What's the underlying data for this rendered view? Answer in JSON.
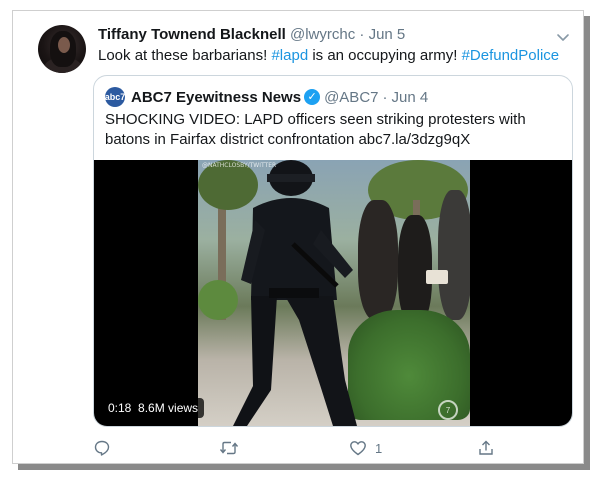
{
  "tweet": {
    "author_name": "Tiffany Townend Blacknell",
    "handle": "@lwyrchc",
    "separator": "·",
    "date": "Jun 5",
    "text_before": "Look at these barbarians! ",
    "hashtag_lapd": "#lapd",
    "text_middle": " is an occupying army! ",
    "hashtag_defund": "#DefundPolice"
  },
  "quoted": {
    "avatar_label": "abc7",
    "author_name": "ABC7 Eyewitness News",
    "handle": "@ABC7",
    "separator": "·",
    "date": "Jun 4",
    "text": "SHOCKING VIDEO: LAPD officers seen striking protesters with batons in Fairfax district confrontation abc7.la/3dzg9qX",
    "video": {
      "watermark": "@NATHCLOSBY/TWITTER",
      "duration": "0:18",
      "views": "8.6M views",
      "bug": "7"
    }
  },
  "actions": {
    "like_count": "1"
  },
  "icons": [
    "caret-down-icon",
    "verified-icon",
    "reply-icon",
    "retweet-icon",
    "like-icon",
    "share-icon"
  ],
  "colors": {
    "link": "#1b95e0",
    "muted": "#657786",
    "verified": "#1da1f2"
  }
}
